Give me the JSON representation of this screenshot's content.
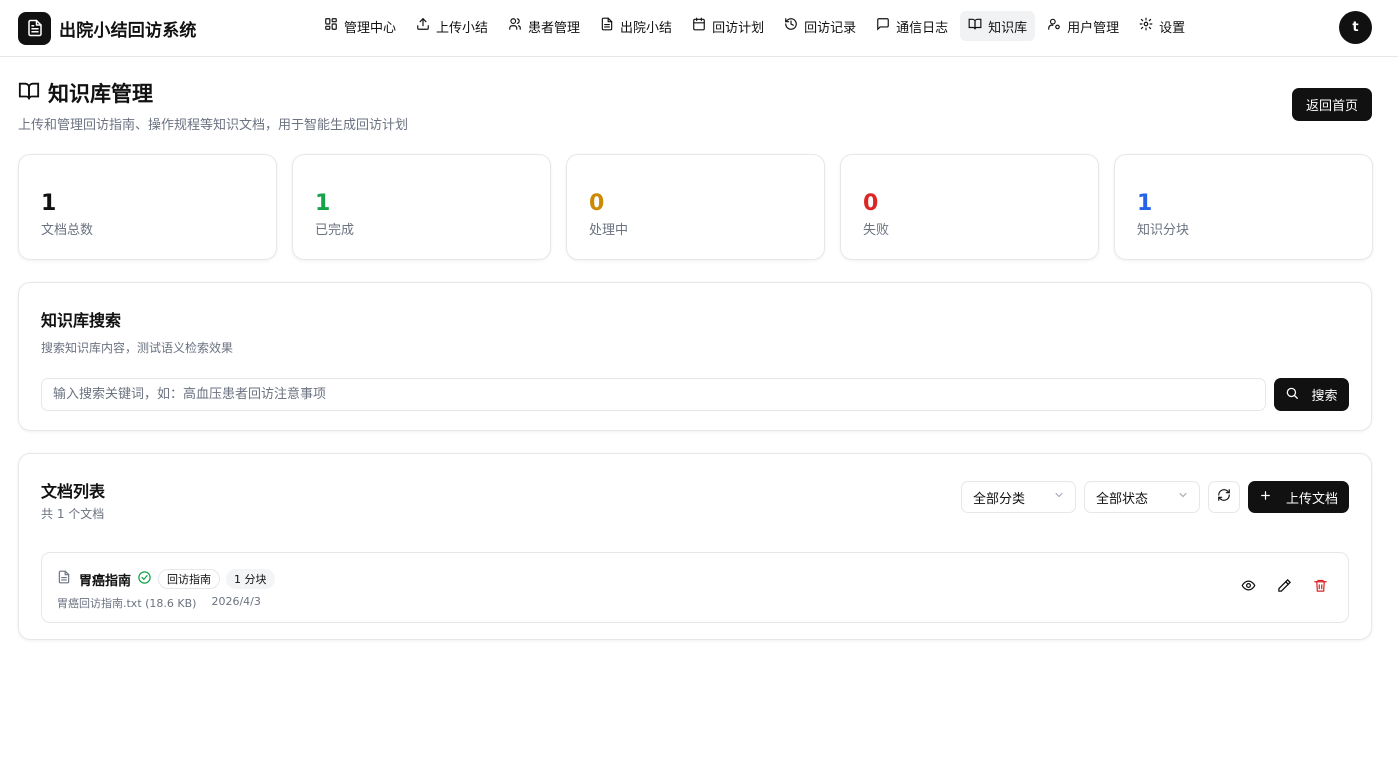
{
  "app": {
    "title": "出院小结回访系统",
    "avatar_initial": "t"
  },
  "nav": [
    {
      "label": "管理中心",
      "icon": "dashboard-icon"
    },
    {
      "label": "上传小结",
      "icon": "upload-icon"
    },
    {
      "label": "患者管理",
      "icon": "users-icon"
    },
    {
      "label": "出院小结",
      "icon": "document-icon"
    },
    {
      "label": "回访计划",
      "icon": "calendar-icon"
    },
    {
      "label": "回访记录",
      "icon": "history-icon"
    },
    {
      "label": "通信日志",
      "icon": "message-icon"
    },
    {
      "label": "知识库",
      "icon": "book-icon",
      "active": true
    },
    {
      "label": "用户管理",
      "icon": "user-settings-icon"
    },
    {
      "label": "设置",
      "icon": "gear-icon"
    }
  ],
  "page": {
    "title": "知识库管理",
    "subtitle": "上传和管理回访指南、操作规程等知识文档，用于智能生成回访计划",
    "back_label": "返回首页"
  },
  "stats": [
    {
      "value": "1",
      "label": "文档总数",
      "color": "#111111"
    },
    {
      "value": "1",
      "label": "已完成",
      "color": "#16a34a"
    },
    {
      "value": "0",
      "label": "处理中",
      "color": "#ca8a04"
    },
    {
      "value": "0",
      "label": "失败",
      "color": "#dc2626"
    },
    {
      "value": "1",
      "label": "知识分块",
      "color": "#2563eb"
    }
  ],
  "search": {
    "title": "知识库搜索",
    "description": "搜索知识库内容，测试语义检索效果",
    "placeholder": "输入搜索关键词，如：高血压患者回访注意事项",
    "button_label": "搜索"
  },
  "documents": {
    "title": "文档列表",
    "count_text": "共 1 个文档",
    "category_filter": "全部分类",
    "status_filter": "全部状态",
    "upload_label": "上传文档",
    "items": [
      {
        "name": "胃癌指南",
        "status": "completed",
        "category": "回访指南",
        "chunks": "1 分块",
        "file": "胃癌回访指南.txt (18.6 KB)",
        "date": "2026/4/3"
      }
    ]
  },
  "colors": {
    "accent": "#111111",
    "success": "#16a34a",
    "warning": "#ca8a04",
    "danger": "#dc2626",
    "info": "#2563eb",
    "muted": "#6b7280"
  }
}
